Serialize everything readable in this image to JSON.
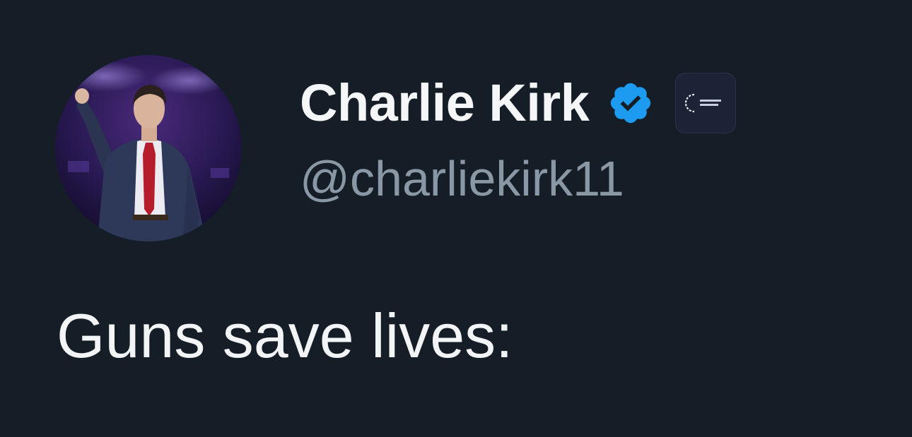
{
  "tweet": {
    "author": {
      "display_name": "Charlie Kirk",
      "handle": "@charliekirk11",
      "verified": true,
      "verified_icon": "verified-badge-icon",
      "affiliate_icon": "organization-affiliate-logo",
      "avatar": "profile-photo"
    },
    "text": "Guns save lives:"
  },
  "colors": {
    "background": "#151d27",
    "name_text": "#f5f6f7",
    "handle_text": "#8a98a6",
    "body_text": "#f2f4f6",
    "verified_blue": "#1d9bf0"
  }
}
